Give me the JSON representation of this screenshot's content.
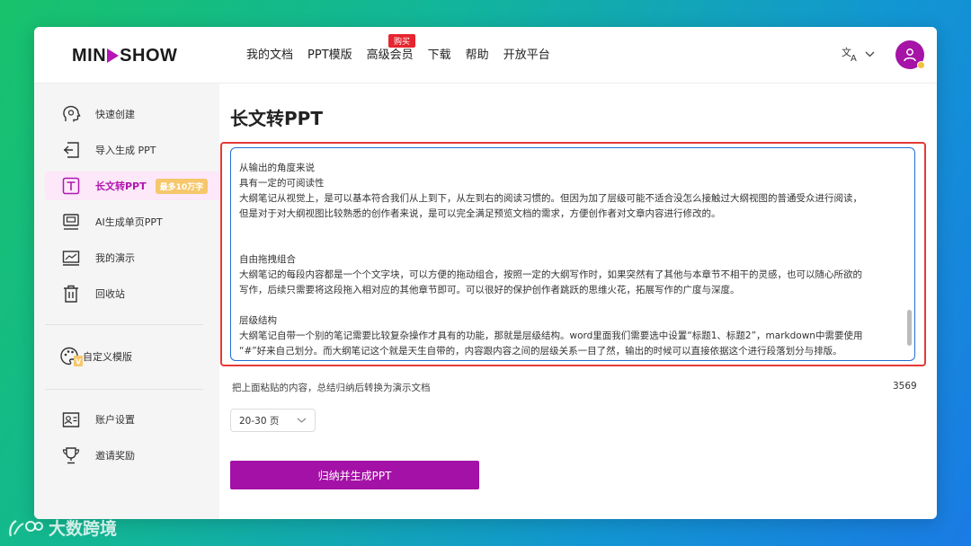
{
  "header": {
    "logo_left": "MIN",
    "logo_right": "SHOW",
    "nav": [
      "我的文档",
      "PPT模版",
      "高级会员",
      "下载",
      "帮助",
      "开放平台"
    ],
    "nav_badge": "购买"
  },
  "sidebar": {
    "items": [
      {
        "label": "快速创建",
        "icon": "lightbulb-head-icon"
      },
      {
        "label": "导入生成 PPT",
        "icon": "import-icon"
      },
      {
        "label": "长文转PPT",
        "icon": "text-t-icon",
        "tag": "最多10万字"
      },
      {
        "label": "AI生成单页PPT",
        "icon": "ai-slide-icon"
      },
      {
        "label": "我的演示",
        "icon": "presentation-icon"
      },
      {
        "label": "回收站",
        "icon": "trash-icon"
      },
      {
        "label": "自定义模版",
        "icon": "palette-icon"
      },
      {
        "label": "账户设置",
        "icon": "id-card-icon"
      },
      {
        "label": "邀请奖励",
        "icon": "trophy-icon"
      }
    ]
  },
  "main": {
    "title": "长文转PPT",
    "editor_lines": [
      "从输出的角度来说",
      "具有一定的可阅读性",
      "大纲笔记从视觉上，是可以基本符合我们从上到下，从左到右的阅读习惯的。但因为加了层级可能不适合没怎么接触过大纲视图的普通受众进行阅读，",
      "但是对于对大纲视图比较熟悉的创作者来说，是可以完全满足预览文档的需求，方便创作者对文章内容进行修改的。",
      "自由拖拽组合",
      "大纲笔记的每段内容都是一个个文字块，可以方便的拖动组合，按照一定的大纲写作时，如果突然有了其他与本章节不相干的灵感，也可以随心所欲的",
      "写作，后续只需要将这段拖入相对应的其他章节即可。可以很好的保护创作者跳跃的思维火花，拓展写作的广度与深度。",
      "层级结构",
      "大纲笔记自带一个别的笔记需要比较复杂操作才具有的功能，那就是层级结构。word里面我们需要选中设置“标题1、标题2”，markdown中需要使用",
      "“#”好来自己划分。而大纲笔记这个就是天生自带的，内容跟内容之间的层级关系一目了然，输出的时候可以直接依据这个进行段落划分与排版。"
    ],
    "hint": "把上面粘贴的内容，总结归纳后转换为演示文档",
    "char_count": "3569",
    "page_range": "20-30 页",
    "generate_label": "归纳并生成PPT"
  },
  "watermark": "大数跨境",
  "colors": {
    "brand": "#a411a6",
    "accent_red": "#e53935",
    "editor_border": "#1f6fd6"
  }
}
